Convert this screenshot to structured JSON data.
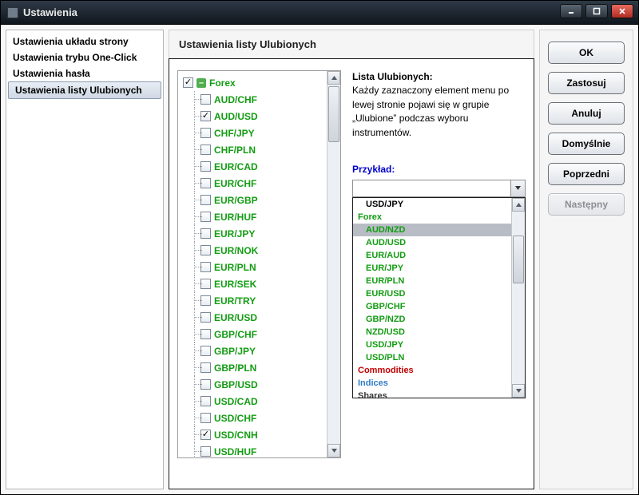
{
  "window": {
    "title": "Ustawienia"
  },
  "sidebar": {
    "items": [
      {
        "label": "Ustawienia układu strony",
        "selected": false
      },
      {
        "label": "Ustawienia trybu One-Click",
        "selected": false
      },
      {
        "label": "Ustawienia hasła",
        "selected": false
      },
      {
        "label": "Ustawienia listy Ulubionych",
        "selected": true
      }
    ]
  },
  "panel": {
    "title": "Ustawienia listy Ulubionych"
  },
  "tree": {
    "root": {
      "label": "Forex",
      "checked": true
    },
    "children": [
      {
        "label": "AUD/CHF",
        "checked": false
      },
      {
        "label": "AUD/USD",
        "checked": true
      },
      {
        "label": "CHF/JPY",
        "checked": false
      },
      {
        "label": "CHF/PLN",
        "checked": false
      },
      {
        "label": "EUR/CAD",
        "checked": false
      },
      {
        "label": "EUR/CHF",
        "checked": false
      },
      {
        "label": "EUR/GBP",
        "checked": false
      },
      {
        "label": "EUR/HUF",
        "checked": false
      },
      {
        "label": "EUR/JPY",
        "checked": false
      },
      {
        "label": "EUR/NOK",
        "checked": false
      },
      {
        "label": "EUR/PLN",
        "checked": false
      },
      {
        "label": "EUR/SEK",
        "checked": false
      },
      {
        "label": "EUR/TRY",
        "checked": false
      },
      {
        "label": "EUR/USD",
        "checked": false
      },
      {
        "label": "GBP/CHF",
        "checked": false
      },
      {
        "label": "GBP/JPY",
        "checked": false
      },
      {
        "label": "GBP/PLN",
        "checked": false
      },
      {
        "label": "GBP/USD",
        "checked": false
      },
      {
        "label": "USD/CAD",
        "checked": false
      },
      {
        "label": "USD/CHF",
        "checked": false
      },
      {
        "label": "USD/CNH",
        "checked": true
      },
      {
        "label": "USD/HUF",
        "checked": false
      }
    ]
  },
  "info": {
    "title": "Lista Ulubionych:",
    "body": "Każdy zaznaczony element menu po lewej stronie pojawi się w grupie „Ulubione” podczas wyboru instrumentów.",
    "example_label": "Przykład:"
  },
  "dropdown": {
    "items": [
      {
        "label": "USD/JPY",
        "kind": "plain"
      },
      {
        "label": "Forex",
        "kind": "forex"
      },
      {
        "label": "AUD/NZD",
        "kind": "indent",
        "selected": true
      },
      {
        "label": "AUD/USD",
        "kind": "indent"
      },
      {
        "label": "EUR/AUD",
        "kind": "indent"
      },
      {
        "label": "EUR/JPY",
        "kind": "indent"
      },
      {
        "label": "EUR/PLN",
        "kind": "indent"
      },
      {
        "label": "EUR/USD",
        "kind": "indent"
      },
      {
        "label": "GBP/CHF",
        "kind": "indent"
      },
      {
        "label": "GBP/NZD",
        "kind": "indent"
      },
      {
        "label": "NZD/USD",
        "kind": "indent"
      },
      {
        "label": "USD/JPY",
        "kind": "indent"
      },
      {
        "label": "USD/PLN",
        "kind": "indent"
      },
      {
        "label": "Commodities",
        "kind": "commodities"
      },
      {
        "label": "Indices",
        "kind": "indices"
      },
      {
        "label": "Shares",
        "kind": "shares"
      }
    ]
  },
  "buttons": {
    "ok": "OK",
    "apply": "Zastosuj",
    "cancel": "Anuluj",
    "default": "Domyślnie",
    "prev": "Poprzedni",
    "next": "Następny"
  }
}
